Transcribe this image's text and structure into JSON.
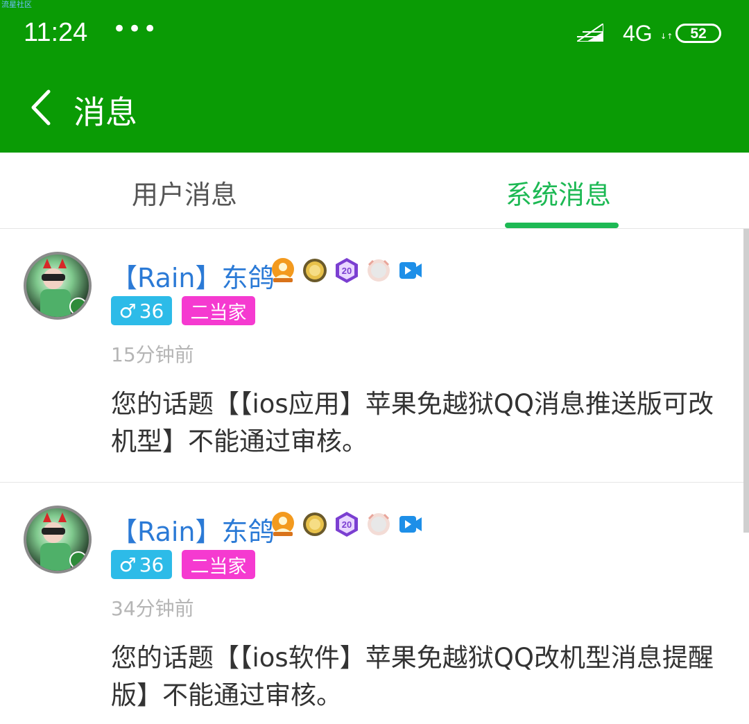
{
  "watermark": "流星社区",
  "status_bar": {
    "time": "11:24",
    "dots": "•••",
    "network": "4G",
    "network_arrows": "↓↑",
    "battery": "52"
  },
  "nav": {
    "title": "消息"
  },
  "tabs": [
    {
      "label": "用户消息",
      "active": false
    },
    {
      "label": "系统消息",
      "active": true
    }
  ],
  "messages": [
    {
      "name": "【Rain】东鸽",
      "gender_symbol": "♂",
      "age": "36",
      "rank": "二当家",
      "time": "15分钟前",
      "text": "您的话题【【ios应用】苹果免越狱QQ消息推送版可改机型】不能通过审核。",
      "medal_level": "20"
    },
    {
      "name": "【Rain】东鸽",
      "gender_symbol": "♂",
      "age": "36",
      "rank": "二当家",
      "time": "34分钟前",
      "text": "您的话题【【ios软件】苹果免越狱QQ改机型消息提醒版】不能通过审核。",
      "medal_level": "20"
    }
  ],
  "colors": {
    "header": "#0a9b05",
    "accent": "#1db954",
    "name": "#2b7ad6",
    "gender_badge": "#2dbbe8",
    "rank_badge": "#f53ad0"
  }
}
